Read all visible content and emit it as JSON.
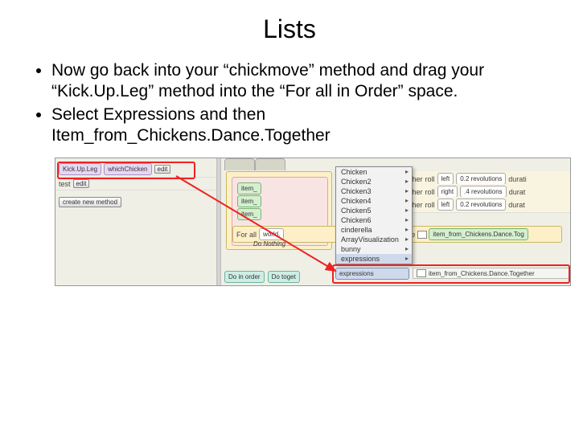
{
  "title": "Lists",
  "bullets": [
    "Now go back into your “chickmove” method and drag your “Kick.Up.Leg” method into the “For all in Order” space.",
    "Select Expressions and then Item_from_Chickens.Dance.Together"
  ],
  "left_panel": {
    "row1": {
      "method": "Kick.Up.Leg",
      "param": "whichChicken",
      "edit": "edit"
    },
    "row2": {
      "method": "test",
      "edit": "edit"
    },
    "create_btn": "create new method"
  },
  "right_panel": {
    "items_label": "item_",
    "turn_rows": [
      {
        "dir": "left",
        "amt": "0.2 revolutions",
        "extra": "durati"
      },
      {
        "dir": "right",
        "amt": ".4 revolutions",
        "extra": "durat"
      },
      {
        "dir": "left",
        "amt": "0.2 revolutions",
        "extra": "durat"
      }
    ],
    "for_all": "For all",
    "world": "world.",
    "one": ", one",
    "token_item": "item_from_Chickens.Dance.Tog",
    "do_nothing": "Do Nothing",
    "tabs": {
      "t1": "Do in order",
      "t2": "Do toget"
    },
    "expressions_label": "expressions",
    "expr_result": "item_from_Chickens.Dance.Together",
    "ether_label": "ether",
    "roll": "roll"
  },
  "context_menu": {
    "items": [
      "Chicken",
      "Chicken2",
      "Chicken3",
      "Chicken4",
      "Chicken5",
      "Chicken6",
      "cinderella",
      "ArrayVisualization",
      "bunny"
    ],
    "selected": "expressions"
  }
}
